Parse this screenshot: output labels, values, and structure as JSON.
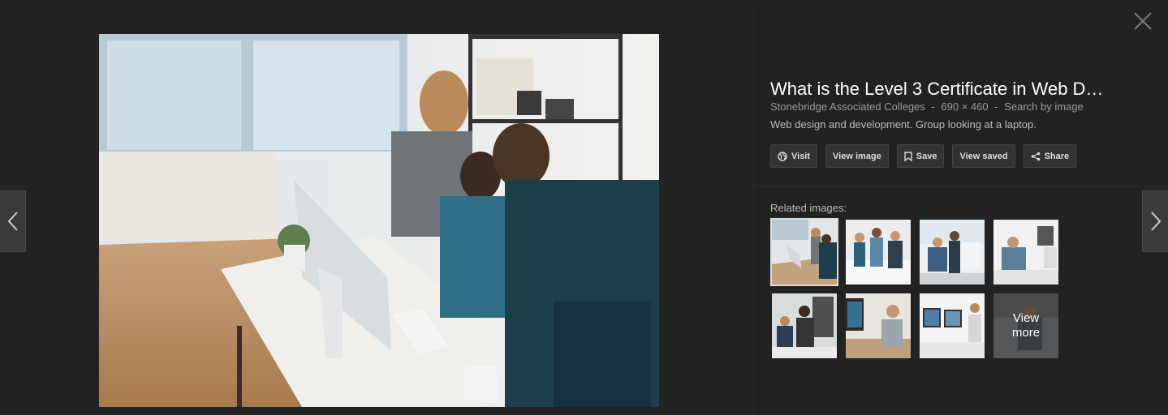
{
  "viewer": {
    "close_icon": "close-icon",
    "prev_icon": "chevron-left-icon",
    "next_icon": "chevron-right-icon"
  },
  "image": {
    "title": "What is the Level 3 Certificate in Web D…",
    "source": "Stonebridge Associated Colleges",
    "dimensions": "690 × 460",
    "search_by_image": "Search by image",
    "separator": "-",
    "description": "Web design and development. Group looking at a laptop."
  },
  "actions": {
    "visit": "Visit",
    "view_image": "View image",
    "save": "Save",
    "view_saved": "View saved",
    "share": "Share"
  },
  "related": {
    "label": "Related images:",
    "view_more": "View more"
  },
  "colors": {
    "background": "#222222",
    "button_bg": "#333333",
    "muted_text": "#999999"
  }
}
